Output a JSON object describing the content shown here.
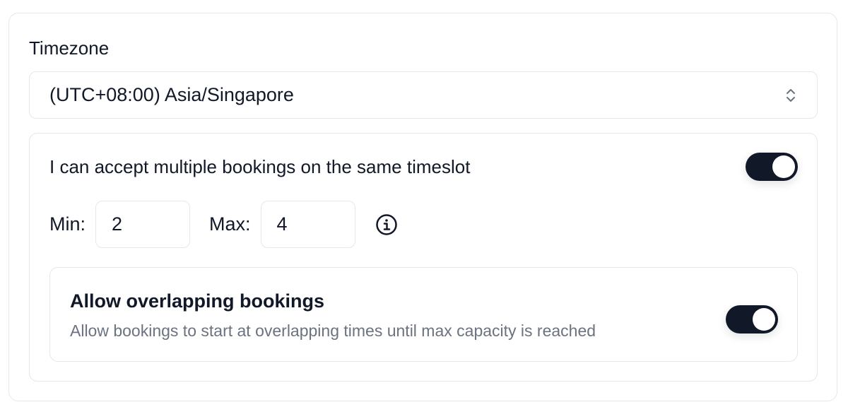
{
  "timezone": {
    "label": "Timezone",
    "selected": "(UTC+08:00) Asia/Singapore",
    "chevron_icon": "chevron-up-down-icon"
  },
  "multiple_bookings": {
    "label": "I can accept multiple bookings on the same timeslot",
    "enabled": true,
    "min_label": "Min:",
    "min_value": "2",
    "max_label": "Max:",
    "max_value": "4",
    "info_icon": "info-icon"
  },
  "overlapping": {
    "title": "Allow overlapping bookings",
    "description": "Allow bookings to start at overlapping times until max capacity is reached",
    "enabled": true
  },
  "colors": {
    "toggle_on": "#111827",
    "border": "#e5e7eb",
    "muted_text": "#6b7280"
  }
}
